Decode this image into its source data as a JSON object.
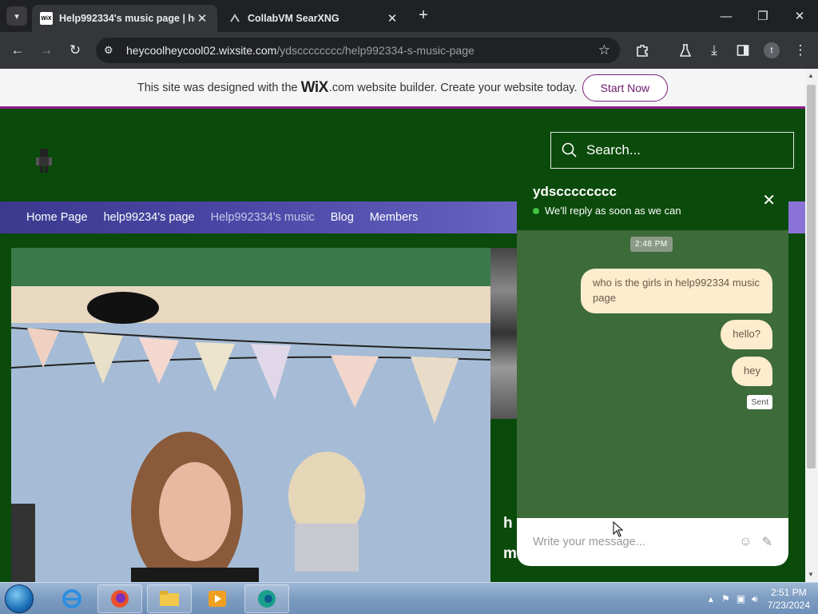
{
  "browser": {
    "tabs": [
      {
        "title": "Help992334's music page | hel",
        "favicon": "WiX",
        "active": true
      },
      {
        "title": "CollabVM SearXNG",
        "favicon": "searxng-icon",
        "active": false
      }
    ],
    "address": {
      "host": "heycoolheycool02.wixsite.com",
      "path": "/ydscccccccc/help992334-s-music-page"
    },
    "profile_initial": "t"
  },
  "wix_banner": {
    "prefix": "This site was designed with the",
    "logo": "WiX",
    "suffix": ".com website builder. Create your website today.",
    "cta": "Start Now"
  },
  "site": {
    "search_placeholder": "Search...",
    "nav": [
      "Home Page",
      "help99234's page",
      "Help992334's music",
      "Blog",
      "Members"
    ],
    "partial_heading_1": "h",
    "partial_heading_2": "m"
  },
  "chat": {
    "name": "ydscccccccc",
    "status": "We'll reply as soon as we can",
    "timestamp": "2:48 PM",
    "messages": [
      "who is the girls in help992334 music page",
      "hello?",
      "hey"
    ],
    "sent_label": "Sent",
    "input_placeholder": "Write your message..."
  },
  "taskbar": {
    "time": "2:51 PM",
    "date": "7/23/2024"
  }
}
